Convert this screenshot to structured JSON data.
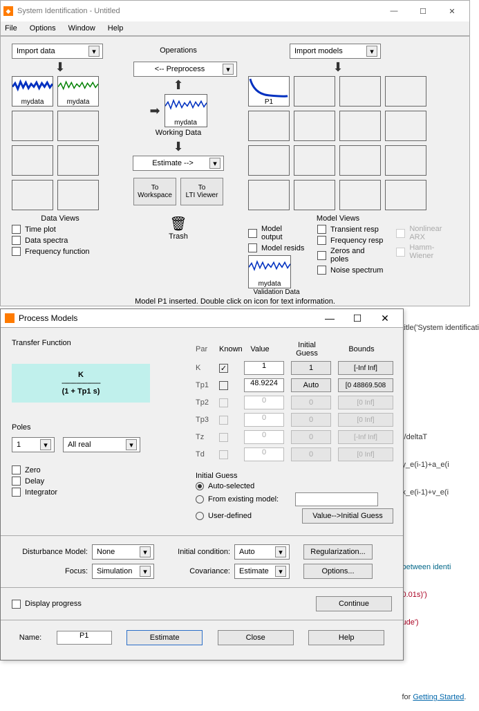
{
  "si": {
    "title": "System Identification - Untitled",
    "menu": {
      "file": "File",
      "options": "Options",
      "window": "Window",
      "help": "Help"
    },
    "import_data": "Import data",
    "import_models": "Import models",
    "operations": "Operations",
    "preprocess": "<-- Preprocess",
    "estimate": "Estimate -->",
    "working_data": "Working Data",
    "data_views": "Data Views",
    "model_views": "Model Views",
    "to_workspace": "To\nWorkspace",
    "to_lti": "To\nLTI Viewer",
    "trash": "Trash",
    "validation": "Validation Data",
    "status": "Model P1 inserted. Double click on icon for text information.",
    "data_slots": {
      "d1": "mydata",
      "d2": "mydata"
    },
    "work_slot": "mydata",
    "val_slot": "mydata",
    "model_slots": {
      "m1": "P1"
    },
    "chk_data": {
      "time": "Time plot",
      "spectra": "Data spectra",
      "freq": "Frequency function"
    },
    "chk_model": {
      "output": "Model output",
      "resids": "Model resids",
      "transient": "Transient resp",
      "freq": "Frequency resp",
      "zeros": "Zeros and poles",
      "noise": "Noise spectrum",
      "nlarx": "Nonlinear ARX",
      "hw": "Hamm-Wiener"
    }
  },
  "pm": {
    "title": "Process Models",
    "tf_label": "Transfer Function",
    "tf_num": "K",
    "tf_den": "(1 + Tp1 s)",
    "poles_label": "Poles",
    "poles_n": "1",
    "poles_type": "All real",
    "zero": "Zero",
    "delay": "Delay",
    "integrator": "Integrator",
    "hdr": {
      "par": "Par",
      "known": "Known",
      "value": "Value",
      "init": "Initial Guess",
      "bounds": "Bounds"
    },
    "rows": {
      "K": {
        "lbl": "K",
        "known": true,
        "val": "1",
        "init": "1",
        "bnd": "[-Inf Inf]",
        "en": true
      },
      "Tp1": {
        "lbl": "Tp1",
        "known": false,
        "val": "48.9224",
        "init": "Auto",
        "bnd": "[0 48869.508",
        "en": true
      },
      "Tp2": {
        "lbl": "Tp2",
        "known": false,
        "val": "0",
        "init": "0",
        "bnd": "[0 Inf]",
        "en": false
      },
      "Tp3": {
        "lbl": "Tp3",
        "known": false,
        "val": "0",
        "init": "0",
        "bnd": "[0 Inf]",
        "en": false
      },
      "Tz": {
        "lbl": "Tz",
        "known": false,
        "val": "0",
        "init": "0",
        "bnd": "[-Inf Inf]",
        "en": false
      },
      "Td": {
        "lbl": "Td",
        "known": false,
        "val": "0",
        "init": "0",
        "bnd": "[0 Inf]",
        "en": false
      }
    },
    "ig": {
      "title": "Initial Guess",
      "auto": "Auto-selected",
      "existing": "From existing model:",
      "user": "User-defined",
      "btn": "Value-->Initial Guess"
    },
    "dist": "Disturbance Model:",
    "dist_v": "None",
    "focus": "Focus:",
    "focus_v": "Simulation",
    "init_cond": "Initial condition:",
    "init_cond_v": "Auto",
    "cov": "Covariance:",
    "cov_v": "Estimate",
    "reg": "Regularization...",
    "opts": "Options...",
    "display_prog": "Display progress",
    "continue": "Continue",
    "name": "Name:",
    "name_v": "P1",
    "estimate": "Estimate",
    "close": "Close",
    "help": "Help"
  },
  "bg": {
    "line1": "title('System identificati",
    "line2": ";/deltaT",
    "line3": "y_e(i-1)+a_e(i",
    "line4": "x_e(i-1)+v_e(i",
    "line5": "between identi",
    "line6": "0.01s)')",
    "line7": "ude')",
    "line8": "for ",
    "link": "Getting Started"
  }
}
